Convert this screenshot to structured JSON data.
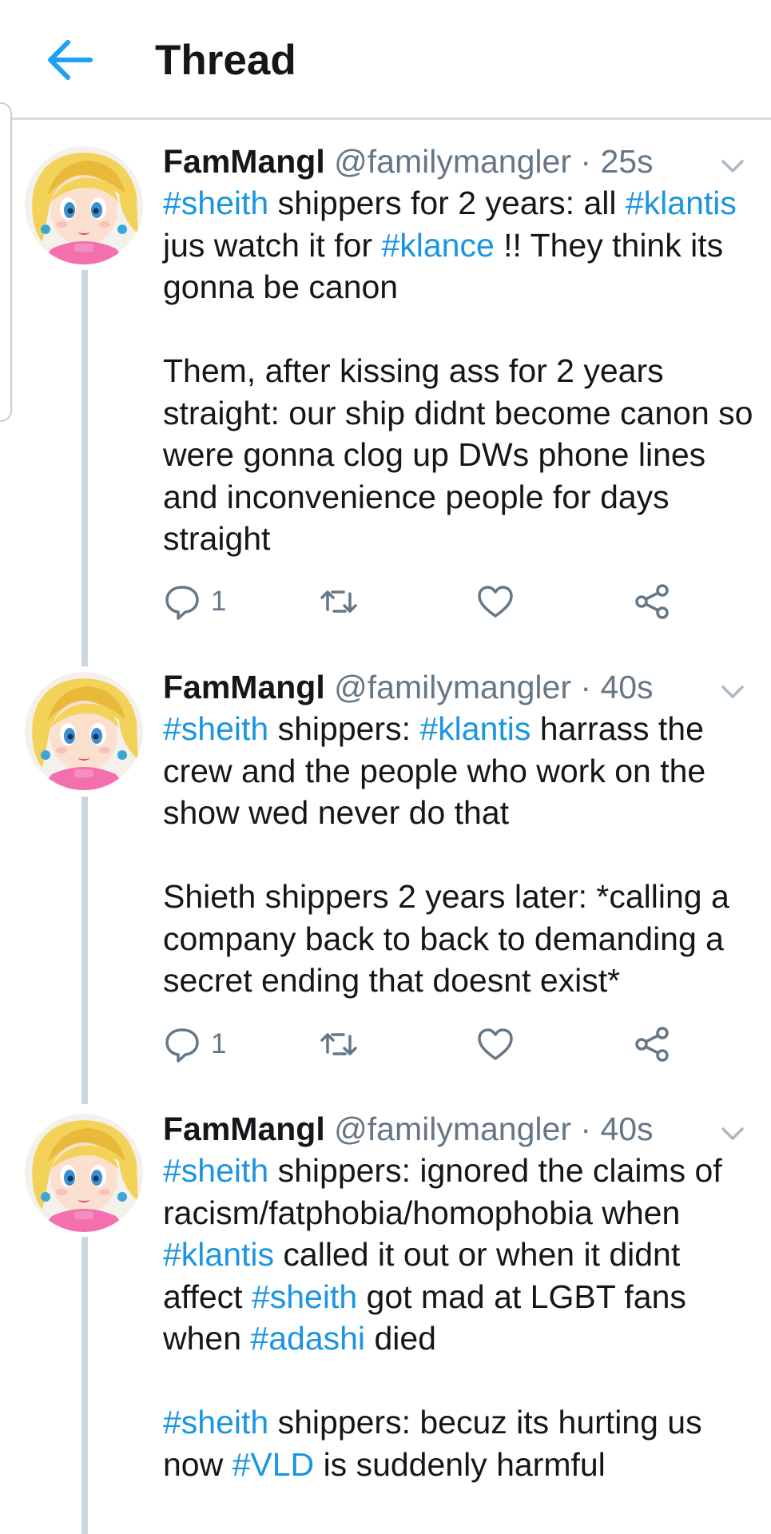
{
  "header": {
    "title": "Thread",
    "back_icon": "arrow-left-icon",
    "accent_color": "#1da1f2"
  },
  "tweets": [
    {
      "name": "FamMangl",
      "handle": "@familymangler",
      "separator": "·",
      "time": "25s",
      "avatar_icon": "avatar-image",
      "paragraphs": [
        [
          {
            "t": "#sheith",
            "h": true
          },
          {
            "t": " shippers for 2 years: all "
          },
          {
            "t": "#klantis",
            "h": true
          },
          {
            "t": " jus watch it for "
          },
          {
            "t": "#klance",
            "h": true
          },
          {
            "t": " !! They think its gonna be canon"
          }
        ],
        [
          {
            "t": "Them, after kissing ass for 2 years straight: our ship didnt become canon so were gonna clog up DWs phone lines and inconvenience people for days straight"
          }
        ]
      ],
      "replies": "1"
    },
    {
      "name": "FamMangl",
      "handle": "@familymangler",
      "separator": "·",
      "time": "40s",
      "avatar_icon": "avatar-image",
      "paragraphs": [
        [
          {
            "t": "#sheith",
            "h": true
          },
          {
            "t": " shippers: "
          },
          {
            "t": "#klantis",
            "h": true
          },
          {
            "t": " harrass the crew and the people who work on the show wed never do that"
          }
        ],
        [
          {
            "t": "Shieth shippers 2 years later: *calling a company back to back to demanding a secret ending that doesnt exist*"
          }
        ]
      ],
      "replies": "1"
    },
    {
      "name": "FamMangl",
      "handle": "@familymangler",
      "separator": "·",
      "time": "40s",
      "avatar_icon": "avatar-image",
      "paragraphs": [
        [
          {
            "t": "#sheith",
            "h": true
          },
          {
            "t": " shippers: ignored the claims of racism/fatphobia/homophobia when "
          },
          {
            "t": "#klantis",
            "h": true
          },
          {
            "t": " called it out or when it didnt affect "
          },
          {
            "t": "#sheith",
            "h": true
          },
          {
            "t": " got mad at LGBT fans when "
          },
          {
            "t": "#adashi",
            "h": true
          },
          {
            "t": " died"
          }
        ],
        [
          {
            "t": "#sheith",
            "h": true
          },
          {
            "t": " shippers: becuz its hurting us now "
          },
          {
            "t": "#VLD",
            "h": true
          },
          {
            "t": " is suddenly harmful"
          }
        ]
      ],
      "replies": ""
    }
  ],
  "icons": {
    "reply": "speech-bubble-icon",
    "retweet": "retweet-icon",
    "like": "heart-icon",
    "share": "share-icon",
    "caret": "chevron-down-icon"
  },
  "colors": {
    "hashtag": "#1b95e0",
    "muted": "#657786",
    "text": "#14171a",
    "thread_line": "#ccd6dd",
    "icon_gray": "#657786"
  }
}
